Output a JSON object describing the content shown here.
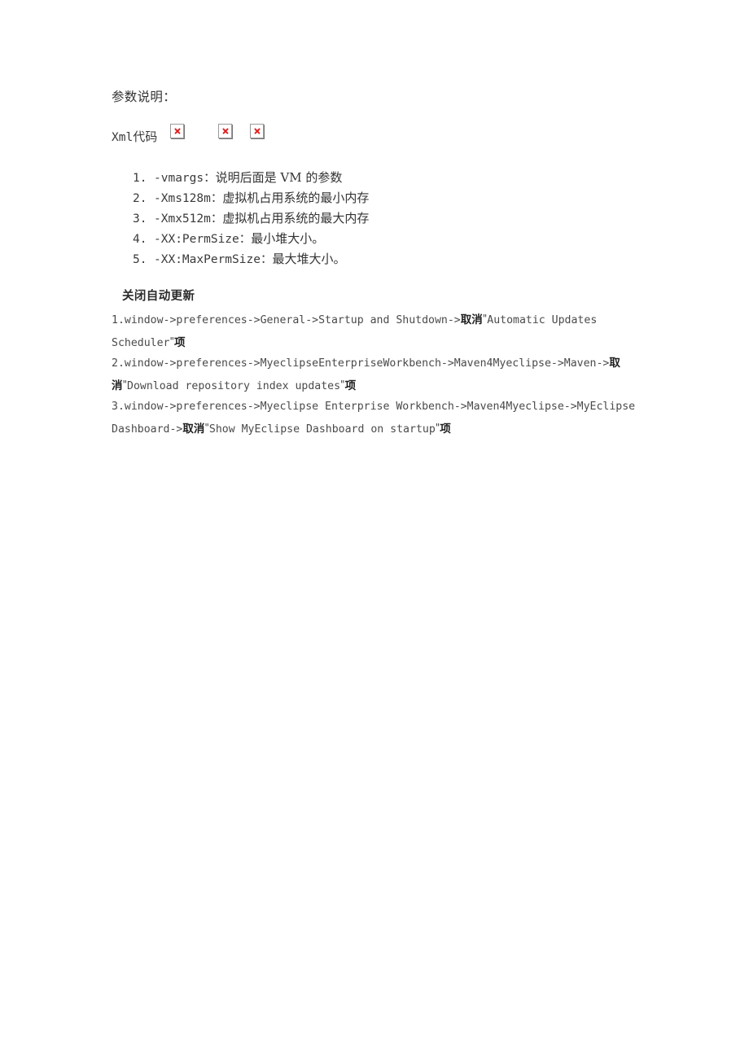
{
  "document": {
    "intro_title": "参数说明：",
    "xml_label_code": "Xml",
    "xml_label_cn": "代码",
    "broken_image_alt": "×"
  },
  "params": {
    "items": [
      {
        "num": "1.",
        "code": "-vmargs：",
        "desc": "说明后面是 VM 的参数"
      },
      {
        "num": "2.",
        "code": "-Xms128m：",
        "desc": "虚拟机占用系统的最小内存"
      },
      {
        "num": "3.",
        "code": "-Xmx512m：",
        "desc": "虚拟机占用系统的最大内存"
      },
      {
        "num": "4.",
        "code": "-XX:PermSize：",
        "desc": "最小堆大小。"
      },
      {
        "num": "5.",
        "code": "-XX:MaxPermSize：",
        "desc": "最大堆大小。"
      }
    ]
  },
  "section": {
    "heading": "关闭自动更新",
    "steps": [
      {
        "index": "1.",
        "path": "window->preferences->General->Startup and Shutdown->",
        "action": "取消",
        "quote_open": "\"",
        "target": "Automatic Updates Scheduler",
        "quote_close": "\"",
        "suffix": "项"
      },
      {
        "index": "2.",
        "path": "window->preferences->MyeclipseEnterpriseWorkbench->Maven4Myeclipse->Maven->",
        "action": "取消",
        "quote_open": "\"",
        "target": "Download repository index updates",
        "quote_close": "\"",
        "suffix": "项"
      },
      {
        "index": "3.",
        "path": "window->preferences->Myeclipse Enterprise Workbench->Maven4Myeclipse->MyEclipse Dashboard->",
        "action": "取消",
        "quote_open": "\"",
        "target": "Show MyEclipse Dashboard on startup",
        "quote_close": "\"",
        "suffix": "项"
      }
    ]
  },
  "colors": {
    "background": "#ffffff",
    "text": "#3a3a3a",
    "heading": "#2b2b2b",
    "broken_icon_mark": "#e02020",
    "broken_icon_border": "#9a9a9a"
  }
}
